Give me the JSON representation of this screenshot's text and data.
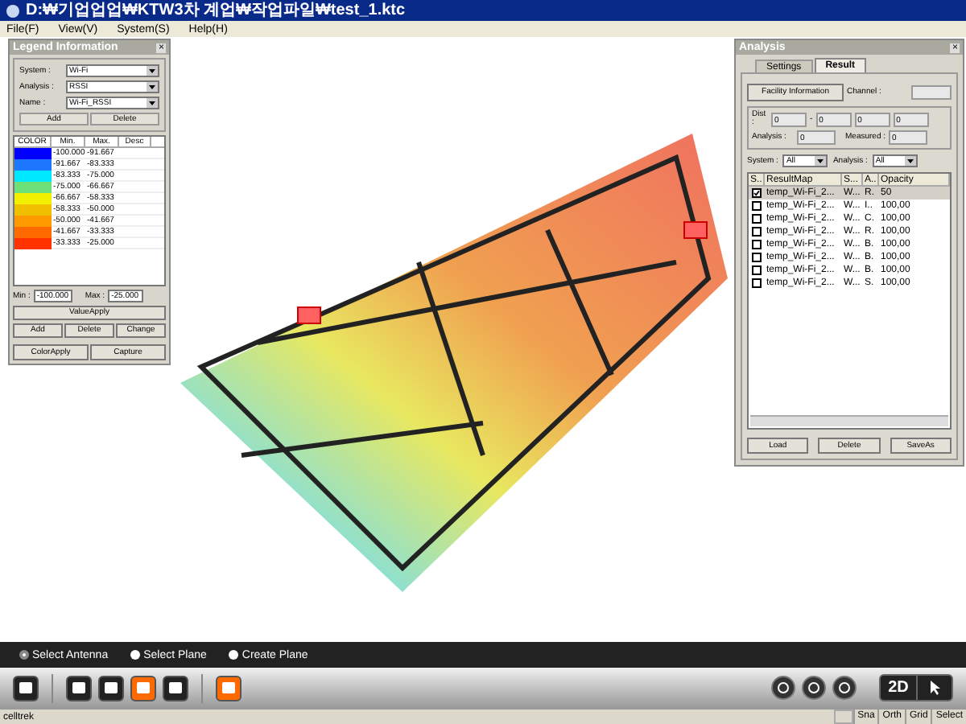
{
  "window": {
    "title": "D:₩기업업업₩KTW3차 계업₩작업파일₩test_1.ktc"
  },
  "menu": [
    "File(F)",
    "View(V)",
    "System(S)",
    "Help(H)"
  ],
  "legend": {
    "title": "Legend Information",
    "close": "×",
    "fields": [
      {
        "label": "System :",
        "value": "Wi-Fi"
      },
      {
        "label": "Analysis :",
        "value": "RSSI"
      },
      {
        "label": "Name :",
        "value": "Wi-Fi_RSSI"
      }
    ],
    "top_buttons": [
      "Add",
      "Delete"
    ],
    "columns": [
      "COLOR",
      "Min.",
      "Max.",
      "Desc"
    ],
    "rows": [
      {
        "color": "#0000ff",
        "min": "-100.000",
        "max": "-91.667"
      },
      {
        "color": "#1e78ff",
        "min": "-91.667",
        "max": "-83.333"
      },
      {
        "color": "#00e8ff",
        "min": "-83.333",
        "max": "-75.000"
      },
      {
        "color": "#6ee07a",
        "min": "-75.000",
        "max": "-66.667"
      },
      {
        "color": "#f0f000",
        "min": "-66.667",
        "max": "-58.333"
      },
      {
        "color": "#f0c000",
        "min": "-58.333",
        "max": "-50.000"
      },
      {
        "color": "#ff9900",
        "min": "-50.000",
        "max": "-41.667"
      },
      {
        "color": "#ff6a00",
        "min": "-41.667",
        "max": "-33.333"
      },
      {
        "color": "#ff3300",
        "min": "-33.333",
        "max": "-25.000"
      }
    ],
    "min_label": "Min :",
    "min_value": "-100.000",
    "max_label": "Max :",
    "max_value": "-25.000",
    "value_apply": "ValueApply",
    "row_buttons": [
      "Add",
      "Delete",
      "Change"
    ],
    "bottom_buttons": [
      "ColorApply",
      "Capture"
    ]
  },
  "analysis": {
    "title": "Analysis",
    "close": "×",
    "tabs": [
      {
        "label": "Settings",
        "selected": false
      },
      {
        "label": "Result",
        "selected": true
      }
    ],
    "facility_button": "Facility Information",
    "channel_label": "Channel :",
    "dist_label": "Dist :",
    "dist_values": [
      "0",
      "0",
      "0",
      "0"
    ],
    "dash": "-",
    "analysis_label": "Analysis :",
    "analysis_value": "0",
    "measured_label": "Measured :",
    "measured_value": "0",
    "system_filter": {
      "label": "System :",
      "value": "All"
    },
    "analysis_filter": {
      "label": "Analysis :",
      "value": "All"
    },
    "columns": [
      "S..",
      "ResultMap",
      "S...",
      "A..",
      "Opacity"
    ],
    "rows": [
      {
        "checked": true,
        "selected": true,
        "map": "temp_Wi-Fi_2...",
        "s": "W...",
        "a": "R.",
        "opacity": "50"
      },
      {
        "checked": false,
        "selected": false,
        "map": "temp_Wi-Fi_2...",
        "s": "W...",
        "a": "I..",
        "opacity": "100,00"
      },
      {
        "checked": false,
        "selected": false,
        "map": "temp_Wi-Fi_2...",
        "s": "W...",
        "a": "C.",
        "opacity": "100,00"
      },
      {
        "checked": false,
        "selected": false,
        "map": "temp_Wi-Fi_2...",
        "s": "W...",
        "a": "R.",
        "opacity": "100,00"
      },
      {
        "checked": false,
        "selected": false,
        "map": "temp_Wi-Fi_2...",
        "s": "W...",
        "a": "B.",
        "opacity": "100,00"
      },
      {
        "checked": false,
        "selected": false,
        "map": "temp_Wi-Fi_2...",
        "s": "W...",
        "a": "B.",
        "opacity": "100,00"
      },
      {
        "checked": false,
        "selected": false,
        "map": "temp_Wi-Fi_2...",
        "s": "W...",
        "a": "B.",
        "opacity": "100,00"
      },
      {
        "checked": false,
        "selected": false,
        "map": "temp_Wi-Fi_2...",
        "s": "W...",
        "a": "S.",
        "opacity": "100,00"
      }
    ],
    "buttons": [
      "Load",
      "Delete",
      "SaveAs"
    ]
  },
  "modes": [
    {
      "label": "Select Antenna",
      "selected": true
    },
    {
      "label": "Select Plane",
      "selected": false
    },
    {
      "label": "Create Plane",
      "selected": false
    }
  ],
  "view_button": "2D",
  "status_bar": {
    "text": "celltrek",
    "panes": [
      "Sna",
      "Orth",
      "Grid",
      "Select"
    ]
  }
}
